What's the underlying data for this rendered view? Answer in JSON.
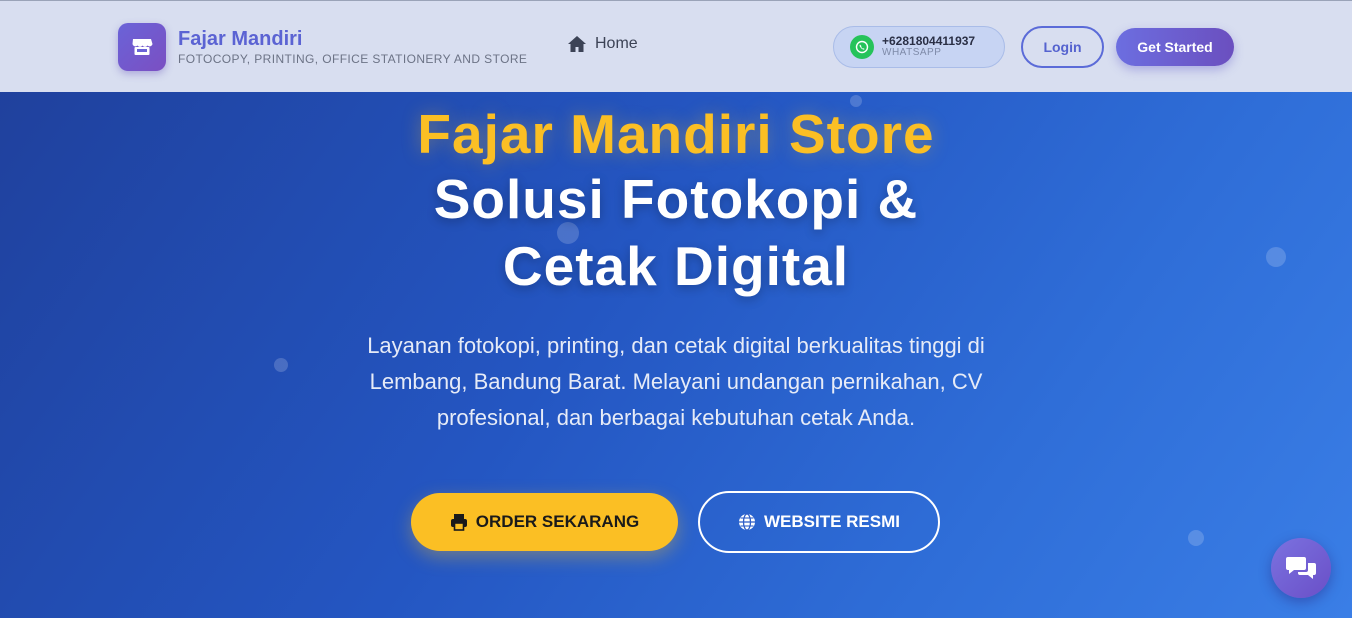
{
  "header": {
    "brand_name": "Fajar Mandiri",
    "brand_tagline": "FOTOCOPY, PRINTING, OFFICE STATIONERY AND STORE",
    "nav_home": "Home",
    "whatsapp_number": "+6281804411937",
    "whatsapp_label": "WHATSAPP",
    "login_label": "Login",
    "get_started_label": "Get Started"
  },
  "hero": {
    "title_highlight": "Fajar Mandiri Store",
    "title_main": "Solusi Fotokopi & Cetak Digital",
    "description": "Layanan fotokopi, printing, dan cetak digital berkualitas tinggi di Lembang, Bandung Barat. Melayani undangan pernikahan, CV profesional, dan berbagai kebutuhan cetak Anda.",
    "order_button": "ORDER SEKARANG",
    "website_button": "WEBSITE RESMI"
  },
  "icons": {
    "brand": "store-icon",
    "home": "home-icon",
    "whatsapp": "whatsapp-icon",
    "order": "printer-icon",
    "website": "globe-icon",
    "chat": "chat-icon"
  },
  "colors": {
    "accent_yellow": "#fbbf24",
    "brand_purple": "#5b63d3",
    "whatsapp_green": "#25c35a",
    "hero_blue": "#2456c2"
  }
}
